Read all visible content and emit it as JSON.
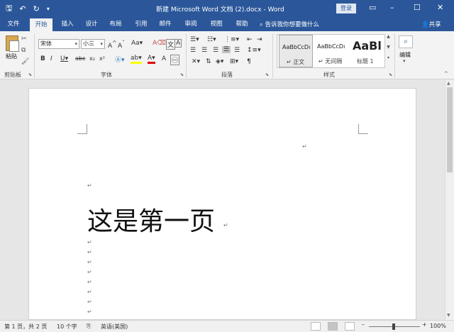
{
  "titlebar": {
    "title": "新建 Microsoft Word 文档 (2).docx - Word",
    "login_label": "登录",
    "save_icon": "save-icon",
    "undo_icon": "undo-icon",
    "redo_icon": "redo-icon",
    "customize_icon": "customize-qat-icon"
  },
  "tabs": [
    {
      "label": "文件"
    },
    {
      "label": "开始"
    },
    {
      "label": "插入"
    },
    {
      "label": "设计"
    },
    {
      "label": "布局"
    },
    {
      "label": "引用"
    },
    {
      "label": "邮件"
    },
    {
      "label": "审阅"
    },
    {
      "label": "视图"
    },
    {
      "label": "帮助"
    }
  ],
  "tellme": "告诉我你想要做什么",
  "share": "共享",
  "ribbon": {
    "clipboard": {
      "paste": "粘贴",
      "label": "剪贴板"
    },
    "font": {
      "name": "宋体",
      "size": "小三",
      "label": "字体"
    },
    "paragraph": {
      "label": "段落"
    },
    "styles": {
      "label": "样式",
      "items": [
        {
          "sample": "AaBbCcDı",
          "name": "↵ 正文"
        },
        {
          "sample": "AaBbCcDı",
          "name": "↵ 无间隔"
        },
        {
          "sample": "AaBl",
          "name": "标题 1"
        }
      ]
    },
    "editing": {
      "label": "编辑"
    }
  },
  "document": {
    "heading": "这是第一页",
    "para_mark": "↵"
  },
  "status": {
    "page": "第 1 页，共 2 页",
    "words": "10 个字",
    "language": "英语(美国)",
    "zoom": "100%"
  }
}
